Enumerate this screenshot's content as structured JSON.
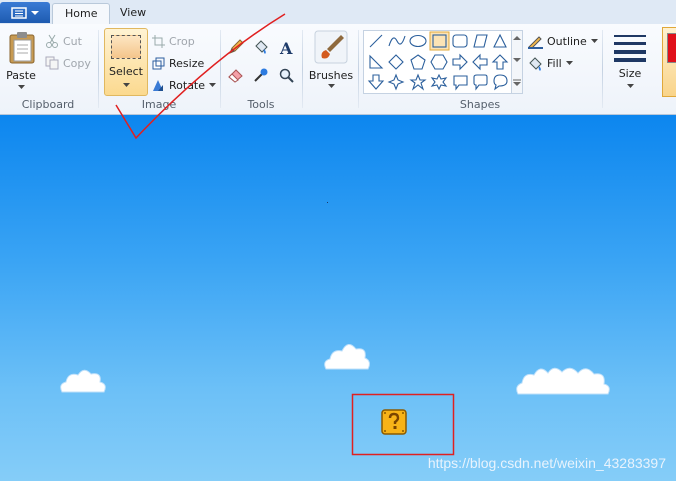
{
  "tabs": [
    {
      "label": "Home"
    },
    {
      "label": "View"
    }
  ],
  "groups": {
    "clipboard": {
      "label": "Clipboard",
      "paste": "Paste",
      "cut": "Cut",
      "copy": "Copy"
    },
    "image": {
      "label": "Image",
      "select": "Select",
      "crop": "Crop",
      "resize": "Resize",
      "rotate": "Rotate"
    },
    "tools": {
      "label": "Tools"
    },
    "brushes": {
      "label": "Brushes"
    },
    "shapes": {
      "label": "Shapes",
      "outline": "Outline",
      "fill": "Fill"
    },
    "size": {
      "label": "Size"
    }
  },
  "icons": {
    "file_menu": "file-menu-icon",
    "pencil": "pencil-icon",
    "fill_bucket": "fill-bucket-icon",
    "text": "text-icon",
    "eraser": "eraser-icon",
    "color_picker": "color-picker-icon",
    "magnifier": "magnifier-icon"
  },
  "colors": {
    "canvas_top": "#0c86ef",
    "canvas_bottom": "#85cdf8",
    "annotation": "#e02020",
    "selected": "#f6c86b"
  },
  "watermark": "https://blog.csdn.net/weixin_43283397"
}
